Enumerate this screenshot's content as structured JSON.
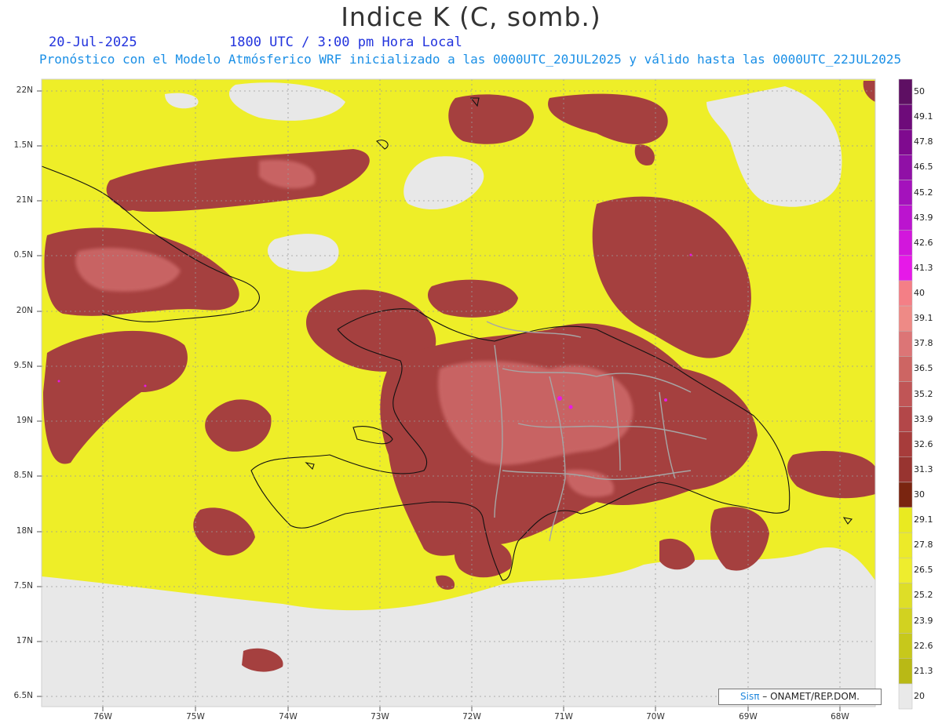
{
  "header": {
    "title": "Indice K (C, somb.)",
    "date": "20-Jul-2025",
    "valid_time": "1800 UTC / 3:00 pm Hora Local",
    "subtitle": "Pronóstico con el Modelo Atmósferico WRF inicializado a las 0000UTC_20JUL2025 y válido hasta las  0000UTC_22JUL2025"
  },
  "axes": {
    "lat_labels": [
      "22N",
      "1.5N",
      "21N",
      "0.5N",
      "20N",
      "9.5N",
      "19N",
      "8.5N",
      "18N",
      "7.5N",
      "17N",
      "6.5N"
    ],
    "lon_labels": [
      "76W",
      "75W",
      "74W",
      "73W",
      "72W",
      "71W",
      "70W",
      "69W",
      "68W"
    ]
  },
  "colorbar": {
    "labels": [
      "50",
      "49.1",
      "47.8",
      "46.5",
      "45.2",
      "43.9",
      "42.6",
      "41.3",
      "40",
      "39.1",
      "37.8",
      "36.5",
      "35.2",
      "33.9",
      "32.6",
      "31.3",
      "30",
      "29.1",
      "27.8",
      "26.5",
      "25.2",
      "23.9",
      "22.6",
      "21.3",
      "20"
    ],
    "colors": [
      "#5e0f63",
      "#6e0b7a",
      "#7f0a8f",
      "#9010a6",
      "#a412bc",
      "#bb14cf",
      "#d217dc",
      "#e619e8",
      "#f47f86",
      "#ee8a86",
      "#dc7576",
      "#cd6563",
      "#c05556",
      "#b34749",
      "#a73c3b",
      "#983430",
      "#7a2510",
      "#e9ea21",
      "#ecea29",
      "#eeed2e",
      "#dede27",
      "#d2d220",
      "#c7c81b",
      "#b9b915",
      "#e9e9e9"
    ]
  },
  "credit": {
    "sis": "Sisπ",
    "org": "– ONAMET/REP.DOM."
  },
  "map_colors": {
    "land_background": "#f0f02a",
    "no_data": "#e9e9e9",
    "high_k": "#a8413f",
    "very_high_k": "#d5706f",
    "coast": "#111111",
    "provinces": "#aaaaaa"
  }
}
